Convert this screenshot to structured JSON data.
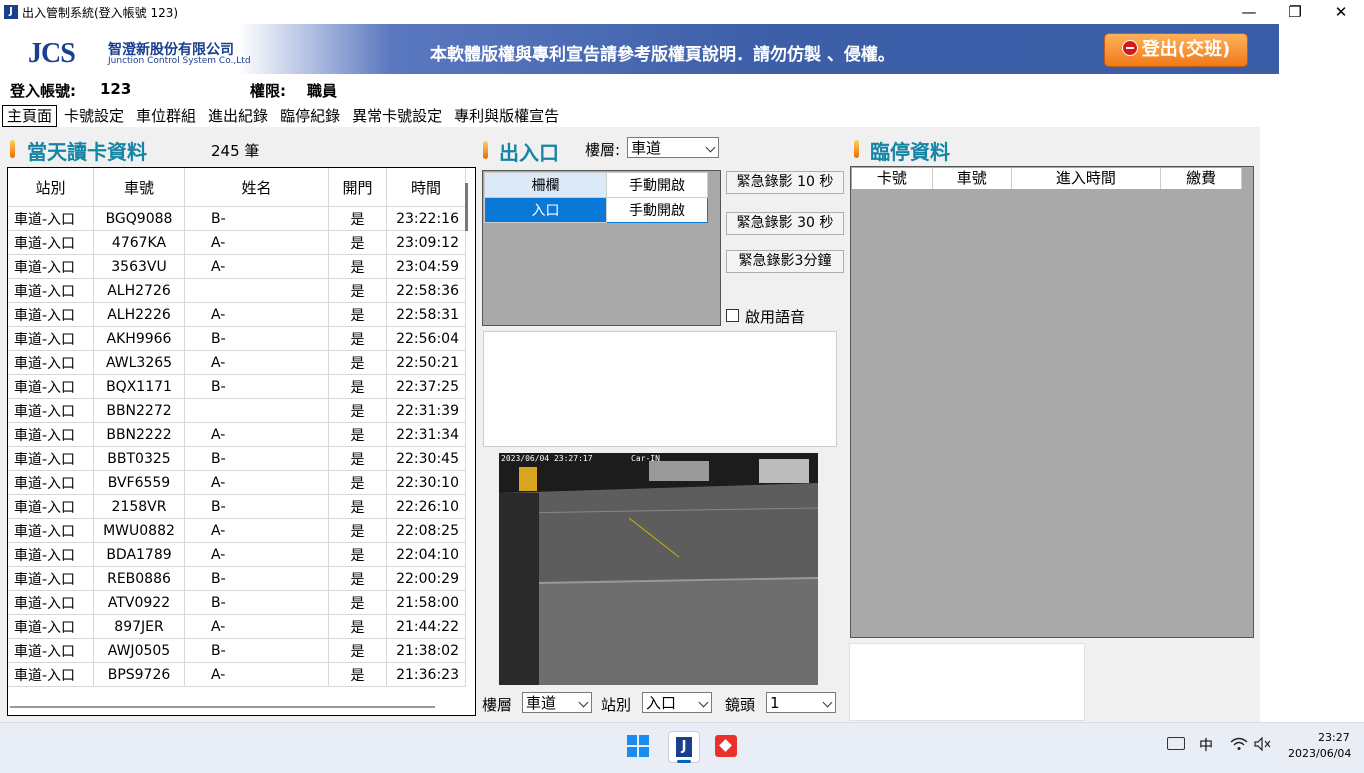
{
  "window": {
    "title": "出入管制系統(登入帳號 123)",
    "min_glyph": "—",
    "max_glyph": "❐",
    "close_glyph": "✕"
  },
  "banner": {
    "logo_text": "JCS",
    "company_cn": "智澄新股份有限公司",
    "company_en": "Junction Control System Co.,Ltd",
    "notice": "本軟體版權與專利宣告請參考版權頁說明．請勿仿製 、侵權。",
    "logout_label": "登出(交班)"
  },
  "account": {
    "id_label": "登入帳號:",
    "id_value": "123",
    "perm_label": "權限:",
    "perm_value": "職員"
  },
  "tabs": [
    "主頁面",
    "卡號設定",
    "車位群組",
    "進出紀錄",
    "臨停紀錄",
    "異常卡號設定",
    "專利與版權宣告"
  ],
  "card_section": {
    "title": "當天讀卡資料",
    "count": "245 筆",
    "columns": [
      "站別",
      "車號",
      "姓名",
      "開門",
      "時間"
    ],
    "rows": [
      [
        "車道-入口",
        "BGQ9088",
        "B-",
        "是",
        "23:22:16"
      ],
      [
        "車道-入口",
        "4767KA",
        "A-",
        "是",
        "23:09:12"
      ],
      [
        "車道-入口",
        "3563VU",
        "A-",
        "是",
        "23:04:59"
      ],
      [
        "車道-入口",
        "ALH2726",
        "",
        "是",
        "22:58:36"
      ],
      [
        "車道-入口",
        "ALH2226",
        "A-",
        "是",
        "22:58:31"
      ],
      [
        "車道-入口",
        "AKH9966",
        "B-",
        "是",
        "22:56:04"
      ],
      [
        "車道-入口",
        "AWL3265",
        "A-",
        "是",
        "22:50:21"
      ],
      [
        "車道-入口",
        "BQX1171",
        "B-",
        "是",
        "22:37:25"
      ],
      [
        "車道-入口",
        "BBN2272",
        "",
        "是",
        "22:31:39"
      ],
      [
        "車道-入口",
        "BBN2222",
        "A-",
        "是",
        "22:31:34"
      ],
      [
        "車道-入口",
        "BBT0325",
        "B-",
        "是",
        "22:30:45"
      ],
      [
        "車道-入口",
        "BVF6559",
        "A-",
        "是",
        "22:30:10"
      ],
      [
        "車道-入口",
        "2158VR",
        "B-",
        "是",
        "22:26:10"
      ],
      [
        "車道-入口",
        "MWU0882",
        "A-",
        "是",
        "22:08:25"
      ],
      [
        "車道-入口",
        "BDA1789",
        "A-",
        "是",
        "22:04:10"
      ],
      [
        "車道-入口",
        "REB0886",
        "B-",
        "是",
        "22:00:29"
      ],
      [
        "車道-入口",
        "ATV0922",
        "B-",
        "是",
        "21:58:00"
      ],
      [
        "車道-入口",
        "897JER",
        "A-",
        "是",
        "21:44:22"
      ],
      [
        "車道-入口",
        "AWJ0505",
        "B-",
        "是",
        "21:38:02"
      ],
      [
        "車道-入口",
        "BPS9726",
        "A-",
        "是",
        "21:36:23"
      ]
    ]
  },
  "gate_section": {
    "title": "出入口",
    "floor_label": "樓層:",
    "floor_value": "車道",
    "panel_header": [
      "柵欄",
      "手動開啟"
    ],
    "panel_row": [
      "入口",
      "手動開啟"
    ],
    "rec_buttons": [
      "緊急錄影 10 秒",
      "緊急錄影 30 秒",
      "緊急錄影3分鐘"
    ],
    "voice_label": "啟用語音",
    "camera_overlay": "2023/06/04 23:27:17        Car-IN",
    "bottom": {
      "floor_label": "樓層",
      "floor_value": "車道",
      "station_label": "站別",
      "station_value": "入口",
      "lens_label": "鏡頭",
      "lens_value": "1"
    }
  },
  "temp_section": {
    "title": "臨停資料",
    "columns": [
      "卡號",
      "車號",
      "進入時間",
      "繳費"
    ]
  },
  "taskbar": {
    "ime": "中",
    "time": "23:27",
    "date": "2023/06/04"
  },
  "colors": {
    "accent": "#1585a5",
    "banner": "#3b5da7",
    "logout": "#f07a1a",
    "selection": "#0a78d7",
    "panel_gray": "#a9a9a9"
  }
}
